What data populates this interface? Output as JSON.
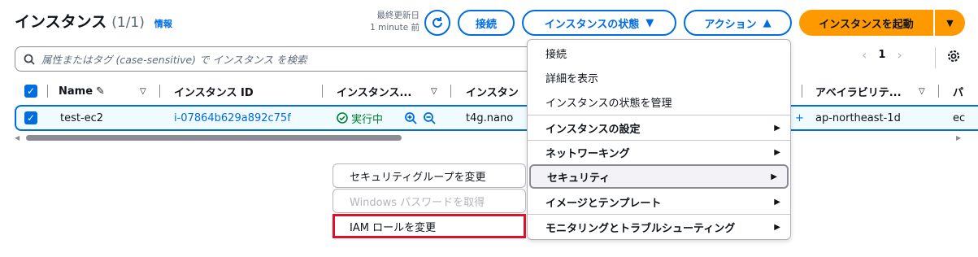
{
  "header": {
    "title": "インスタンス",
    "count": "(1/1)",
    "info_link": "情報",
    "last_updated_label": "最終更新日",
    "last_updated_value": "1 minute 前",
    "connect_label": "接続",
    "instance_state_label": "インスタンスの状態",
    "actions_label": "アクション",
    "launch_label": "インスタンスを起動"
  },
  "search": {
    "placeholder": "属性またはタグ (case-sensitive) で インスタンス を検索"
  },
  "pagination": {
    "prev": "‹",
    "page": "1",
    "next": "›"
  },
  "table": {
    "columns": [
      "Name",
      "インスタンス ID",
      "インスタンス...",
      "インスタン",
      "アベイラビリテ...",
      "パ"
    ],
    "row": {
      "name": "test-ec2",
      "instance_id": "i-07864b629a892c75f",
      "state": "実行中",
      "type": "t4g.nano",
      "az": "ap-northeast-1d",
      "extra": "ec"
    }
  },
  "actions_menu": {
    "items": [
      {
        "label": "接続",
        "group": false
      },
      {
        "label": "詳細を表示",
        "group": false
      },
      {
        "label": "インスタンスの状態を管理",
        "group": false
      },
      {
        "label": "インスタンスの設定",
        "group": true
      },
      {
        "label": "ネットワーキング",
        "group": true
      },
      {
        "label": "セキュリティ",
        "group": true
      },
      {
        "label": "イメージとテンプレート",
        "group": true
      },
      {
        "label": "モニタリングとトラブルシューティング",
        "group": true
      }
    ]
  },
  "security_submenu": {
    "items": [
      {
        "label": "セキュリティグループを変更",
        "disabled": false
      },
      {
        "label": "Windows パスワードを取得",
        "disabled": true
      },
      {
        "label": "IAM ロールを変更",
        "disabled": false,
        "highlighted": true
      }
    ]
  },
  "colors": {
    "accent": "#006ce0",
    "primary_button": "#ff9900",
    "running": "#00802f",
    "highlight_box": "#e0102a"
  }
}
